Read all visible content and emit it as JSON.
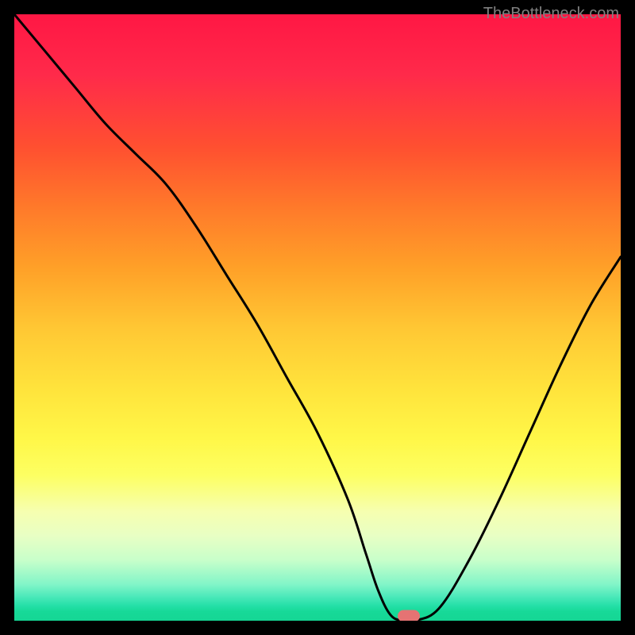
{
  "watermark": "TheBottleneck.com",
  "chart_data": {
    "type": "line",
    "title": "",
    "xlabel": "",
    "ylabel": "",
    "xlim": [
      0,
      100
    ],
    "ylim": [
      0,
      100
    ],
    "x": [
      0,
      5,
      10,
      15,
      20,
      25,
      30,
      35,
      40,
      45,
      50,
      55,
      58,
      60,
      62,
      64,
      66,
      70,
      75,
      80,
      85,
      90,
      95,
      100
    ],
    "values": [
      100,
      94,
      88,
      82,
      77,
      72,
      65,
      57,
      49,
      40,
      31,
      20,
      11,
      5,
      1,
      0,
      0,
      2,
      10,
      20,
      31,
      42,
      52,
      60
    ],
    "marker": {
      "x": 65,
      "y": 0,
      "color": "#e57373"
    },
    "gradient": {
      "top": "#ff1744",
      "mid": "#ffe43c",
      "bottom": "#15d694"
    }
  }
}
